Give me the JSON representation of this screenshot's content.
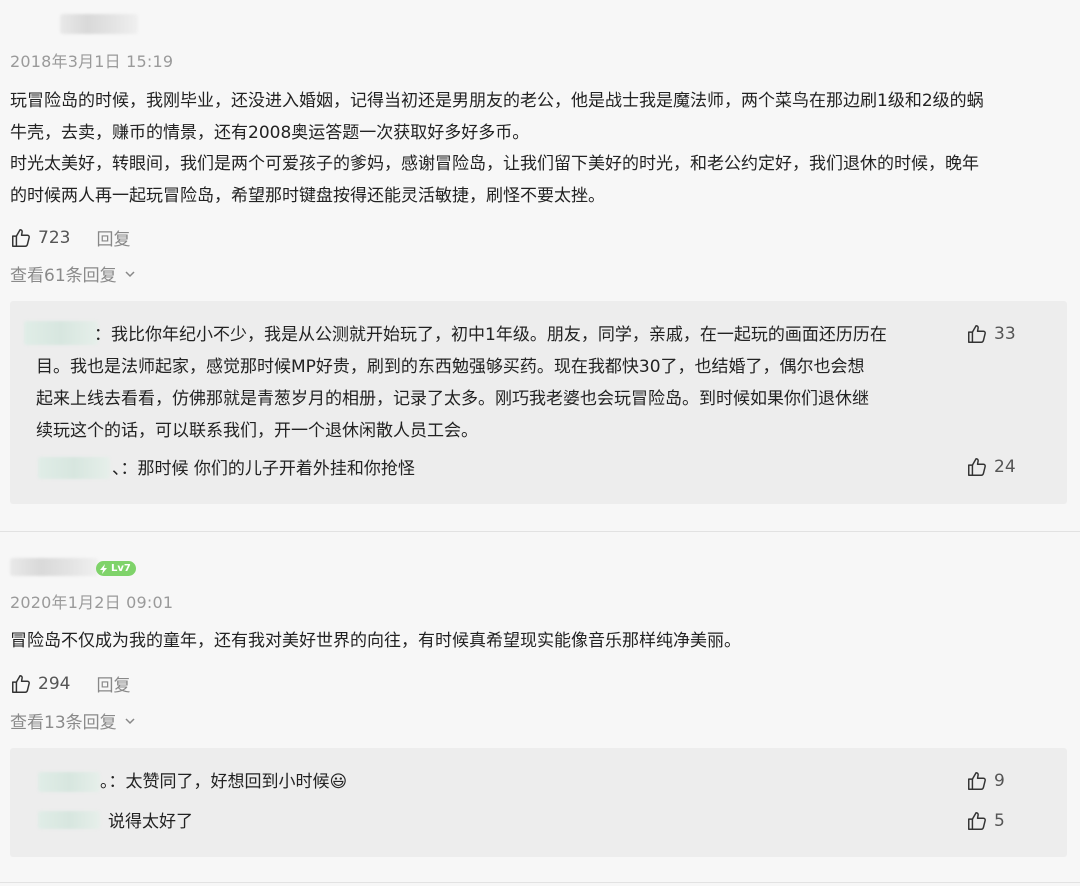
{
  "comments": [
    {
      "date": "2018年3月1日 15:19",
      "text_lines": [
        "玩冒险岛的时候，我刚毕业，还没进入婚姻，记得当初还是男朋友的老公，他是战士我是魔法师，两个菜鸟在那边刷1级和2级的蜗",
        "牛壳，去卖，赚币的情景，还有2008奥运答题一次获取好多好多币。",
        "时光太美好，转眼间，我们是两个可爱孩子的爹妈，感谢冒险岛，让我们留下美好的时光，和老公约定好，我们退休的时候，晚年",
        "的时候两人再一起玩冒险岛，希望那时键盘按得还能灵活敏捷，刷怪不要太挫。"
      ],
      "likes": "723",
      "reply_label": "回复",
      "view_replies": "查看61条回复",
      "replies": [
        {
          "text_lines": [
            "：我比你年纪小不少，我是从公测就开始玩了，初中1年级。朋友，同学，亲戚，在一起玩的画面还历历在",
            "目。我也是法师起家，感觉那时候MP好贵，刷到的东西勉强够买药。现在我都快30了，也结婚了，偶尔也会想",
            "起来上线去看看，仿佛那就是青葱岁月的相册，记录了太多。刚巧我老婆也会玩冒险岛。到时候如果你们退休继",
            "续玩这个的话，可以联系我们，开一个退休闲散人员工会。"
          ],
          "likes": "33"
        },
        {
          "text_lines": [
            "、：那时候 你们的儿子开着外挂和你抢怪"
          ],
          "likes": "24"
        }
      ]
    },
    {
      "badge": "Lv7",
      "date": "2020年1月2日 09:01",
      "text_lines": [
        "冒险岛不仅成为我的童年，还有我对美好世界的向往，有时候真希望现实能像音乐那样纯净美丽。"
      ],
      "likes": "294",
      "reply_label": "回复",
      "view_replies": "查看13条回复",
      "replies": [
        {
          "text_lines": [
            "。：太赞同了，好想回到小时候😃"
          ],
          "likes": "9"
        },
        {
          "text_lines": [
            "说得太好了"
          ],
          "likes": "5"
        }
      ]
    }
  ],
  "colors": {
    "background": "#f7f7f7",
    "reply_box": "#ededed",
    "badge_green": "#7fd36a",
    "muted_text": "#9a9a9a"
  },
  "icons": {
    "like": "thumbs-up-icon",
    "expand": "chevron-down-icon",
    "badge": "lightning-icon"
  }
}
